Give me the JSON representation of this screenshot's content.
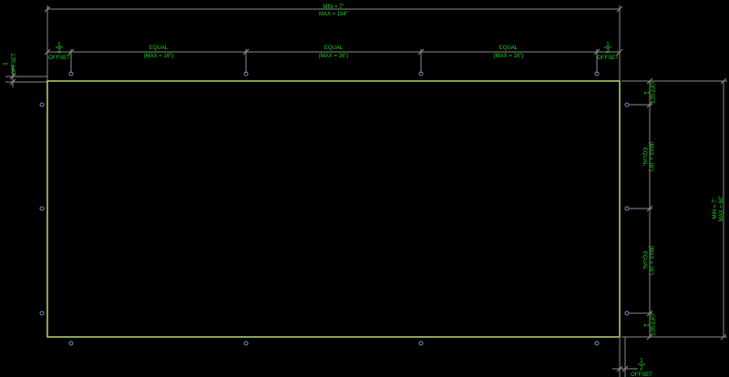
{
  "overall_width": {
    "line1": "MIN = 7\"",
    "line2": "MAX = 194\""
  },
  "overall_height": {
    "line1": "MIN = 7\"",
    "line2": "MAX = 60\""
  },
  "offset_label": "OFFSET",
  "offset_fraction": {
    "numerator": "1",
    "denominator": "2"
  },
  "equal_label": "EQUAL",
  "equal_max": "(MAX = 16\")",
  "colors": {
    "panel": "#b5d86a",
    "text": "#19d619",
    "dim_line": "#8a8a8a",
    "hole": "#6d8fc4"
  }
}
